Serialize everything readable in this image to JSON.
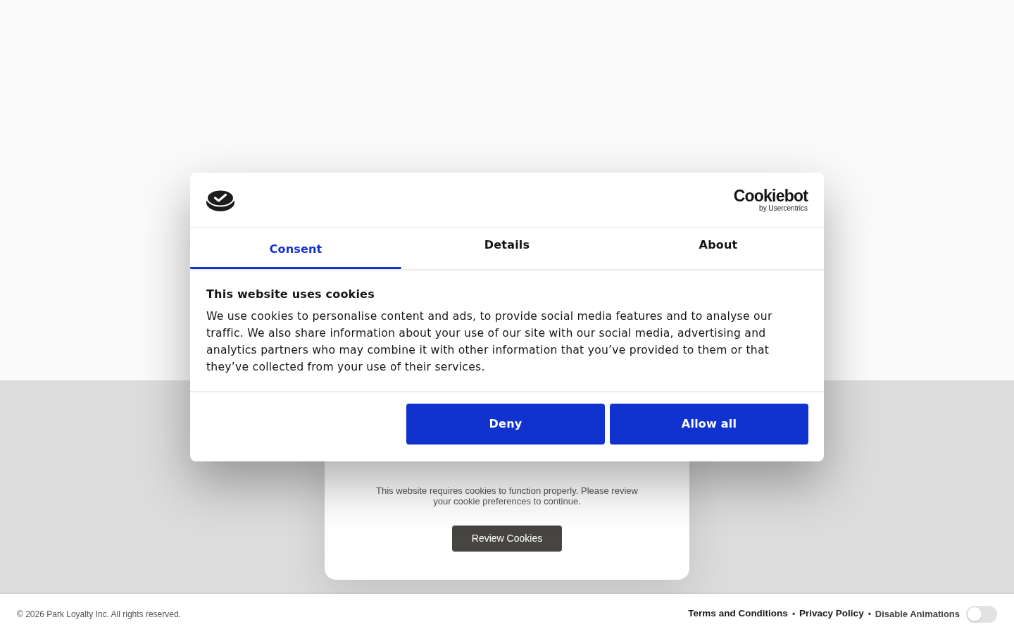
{
  "notice": {
    "text": "This website requires cookies to function properly. Please review your cookie preferences to continue.",
    "button": "Review Cookies"
  },
  "dialog": {
    "brand": {
      "name": "Cookiebot",
      "tagline": "by Usercentrics"
    },
    "tabs": [
      {
        "label": "Consent",
        "selected": true
      },
      {
        "label": "Details",
        "selected": false
      },
      {
        "label": "About",
        "selected": false
      }
    ],
    "title": "This website uses cookies",
    "body": "We use cookies to personalise content and ads, to provide social media features and to analyse our traffic. We also share information about your use of our site with our social media, advertising and analytics partners who may combine it with other information that you’ve provided to them or that they’ve collected from your use of their services.",
    "buttons": [
      {
        "label": "Deny"
      },
      {
        "label": "Allow all"
      }
    ]
  },
  "footer": {
    "copyright": "© 2026 Park Loyalty Inc. All rights reserved.",
    "items": [
      {
        "kind": "link",
        "label": "Terms and Conditions"
      },
      {
        "kind": "separator",
        "label": "•"
      },
      {
        "kind": "link",
        "label": "Privacy Policy"
      },
      {
        "kind": "separator",
        "label": "•"
      },
      {
        "kind": "toggle",
        "label": "Disable Animations",
        "on": false
      }
    ]
  }
}
